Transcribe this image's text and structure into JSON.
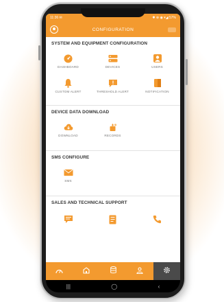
{
  "status": {
    "left": "11:36 ✉",
    "right": "✱ ⊕ ◉ ▾◢ 57%"
  },
  "appbar": {
    "title": "CONFIGURATION"
  },
  "sections": {
    "system": {
      "title": "SYSTEM AND EQUIPMENT CONFIGURATION",
      "items": [
        {
          "label": "DASHBOARD",
          "icon": "dashboard-icon"
        },
        {
          "label": "DEVICES",
          "icon": "devices-icon"
        },
        {
          "label": "USERS",
          "icon": "users-icon"
        },
        {
          "label": "CUSTOM ALERT",
          "icon": "bell-icon"
        },
        {
          "label": "THRESHOLD ALERT",
          "icon": "alert-icon"
        },
        {
          "label": "NOTIFICATION",
          "icon": "notification-icon"
        }
      ]
    },
    "download": {
      "title": "DEVICE DATA DOWNLOAD",
      "items": [
        {
          "label": "DOWNLOAD",
          "icon": "cloud-download-icon"
        },
        {
          "label": "RECORDS",
          "icon": "records-icon"
        }
      ]
    },
    "sms": {
      "title": "SMS CONFIGURE",
      "items": [
        {
          "label": "SMS",
          "icon": "mail-icon"
        }
      ]
    },
    "support": {
      "title": "SALES AND TECHNICAL SUPPORT",
      "items": [
        {
          "label": "",
          "icon": "chat-icon"
        },
        {
          "label": "",
          "icon": "document-icon"
        },
        {
          "label": "",
          "icon": "phone-icon"
        }
      ]
    }
  },
  "nav": [
    "gauge-icon",
    "home-icon",
    "database-icon",
    "user-icon",
    "settings-icon"
  ],
  "colors": {
    "accent": "#f39a2f",
    "nav_active": "#4a4a4a"
  }
}
